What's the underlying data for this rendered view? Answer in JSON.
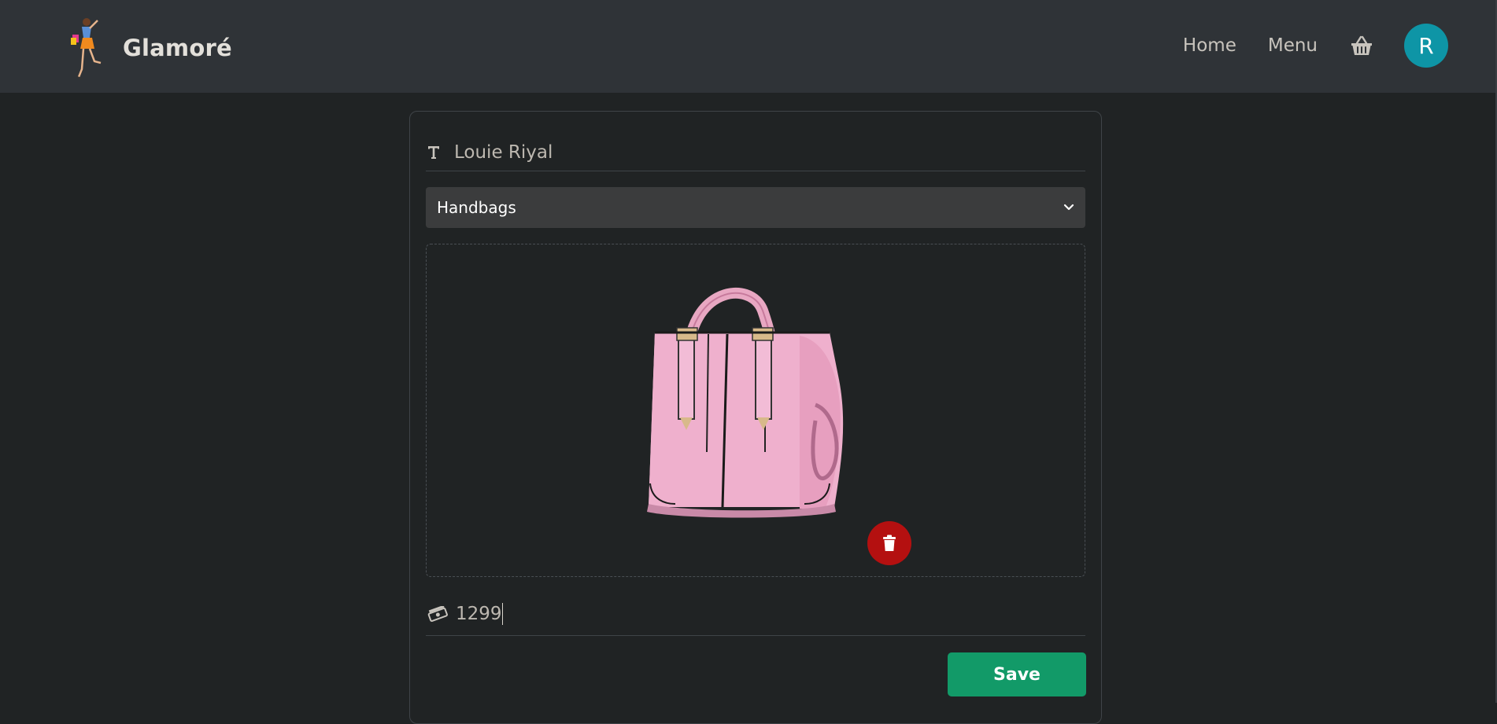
{
  "header": {
    "brand_name": "Glamoré",
    "nav": [
      {
        "label": "Home"
      },
      {
        "label": "Menu"
      }
    ],
    "avatar_initial": "R"
  },
  "form": {
    "title_icon": "text-icon",
    "title_value": "Louie Riyal",
    "category_selected": "Handbags",
    "image_alt": "pink handbag",
    "price_icon": "money-icon",
    "price_value": "1299",
    "delete_icon": "trash-icon",
    "save_label": "Save"
  },
  "colors": {
    "background": "#202324",
    "navbar": "#2f3337",
    "avatar": "#0e95a6",
    "delete": "#b41010",
    "save": "#129a68"
  }
}
